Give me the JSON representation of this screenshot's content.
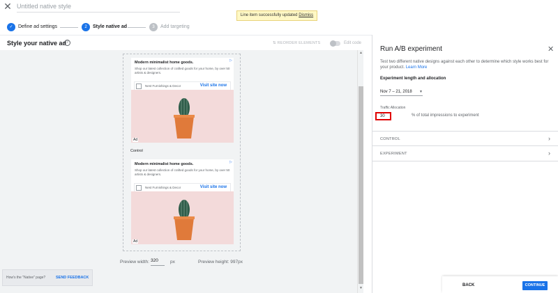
{
  "header": {
    "close_icon": "close-icon",
    "title_placeholder": "Untitled native style",
    "toast": {
      "message": "Line item successfully updated",
      "action": "Dismiss"
    }
  },
  "stepper": {
    "steps": [
      {
        "label": "Define ad settings",
        "state": "done",
        "marker": "✓",
        "color": "#1a73e8"
      },
      {
        "label": "Style native ad",
        "state": "active",
        "marker": "2",
        "color": "#1a73e8"
      },
      {
        "label": "Add targeting",
        "state": "pending",
        "marker": "3",
        "color": "#bdc1c6"
      }
    ]
  },
  "editor": {
    "title": "Style your native ad",
    "help_icon": "help-icon",
    "reorder_label": "REORDER ELEMENTS",
    "edit_code_label": "Edit code",
    "edit_code_enabled": false,
    "preview": {
      "ads": [
        {
          "headline": "Modern minimalist home goods.",
          "body": "Shop our latest collection of crafted goods for your home, by over 50 artists & designers.",
          "brand": "Nest Furnishings & Decor",
          "cta": "Visit site now",
          "badge": "Ad",
          "adchoices_icon": "adchoices-icon"
        },
        {
          "headline": "Modern minimalist home goods.",
          "body": "Shop our latest collection of crafted goods for your home, by over 50 artists & designers.",
          "brand": "Nest Furnishings & Decor",
          "cta": "Visit site now",
          "badge": "Ad",
          "adchoices_icon": "adchoices-icon"
        }
      ],
      "control_label": "Control",
      "width_label": "Preview width:",
      "width_value": "320",
      "width_unit": "px",
      "height_text": "Preview height: 997px"
    },
    "feedback": {
      "question": "How's the \"Native\" page?",
      "button": "SEND FEEDBACK"
    }
  },
  "panel": {
    "title": "Run A/B experiment",
    "description": "Test two different native designs against each other to determine which style works best for your product.",
    "learn_more": "Learn More",
    "experiment_label": "Experiment length and allocation",
    "date_range": "Nov 7 – 21, 2018",
    "traffic_label": "Traffic Allocation",
    "traffic_value": "30",
    "traffic_suffix": "% of total impressions to experiment",
    "sections": [
      {
        "label": "CONTROL"
      },
      {
        "label": "EXPERIMENT"
      }
    ],
    "back_label": "BACK",
    "continue_label": "CONTINUE"
  }
}
